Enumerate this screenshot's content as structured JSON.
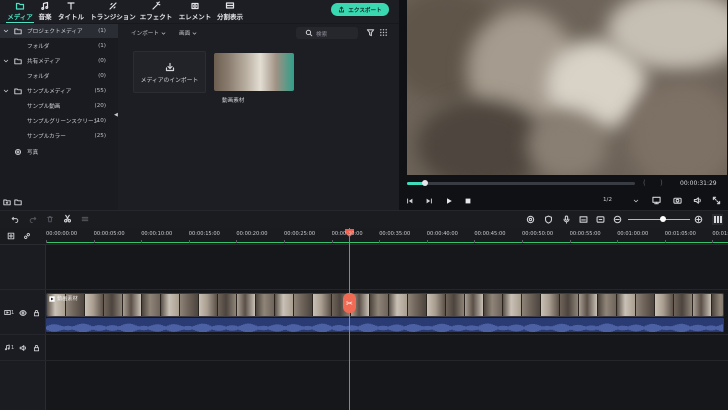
{
  "toolbar": {
    "tabs": [
      {
        "label": "メディア",
        "icon": "folder-icon"
      },
      {
        "label": "音楽",
        "icon": "music-icon"
      },
      {
        "label": "タイトル",
        "icon": "title-icon"
      },
      {
        "label": "トランジション",
        "icon": "transition-icon"
      },
      {
        "label": "エフェクト",
        "icon": "effect-icon"
      },
      {
        "label": "エレメント",
        "icon": "element-icon"
      },
      {
        "label": "分割表示",
        "icon": "split-screen-icon"
      }
    ],
    "export_label": "エクスポート"
  },
  "tree": {
    "items": [
      {
        "label": "プロジェクトメディア",
        "count": "(1)",
        "top_level": true
      },
      {
        "label": "フォルダ",
        "count": "(1)",
        "top_level": false
      },
      {
        "label": "共有メディア",
        "count": "(0)",
        "top_level": true
      },
      {
        "label": "フォルダ",
        "count": "(0)",
        "top_level": false
      },
      {
        "label": "サンプルメディア",
        "count": "(55)",
        "top_level": true
      },
      {
        "label": "サンプル動画",
        "count": "(20)",
        "top_level": false
      },
      {
        "label": "サンプルグリーンスクリーン",
        "count": "(10)",
        "top_level": false
      },
      {
        "label": "サンプルカラー",
        "count": "(25)",
        "top_level": false
      }
    ],
    "photo_label": "写真"
  },
  "media": {
    "import_dropdown": "インポート",
    "view_dropdown": "画面",
    "search_placeholder": "検索",
    "import_card_label": "メディアのインポート",
    "clip_name": "動画素材"
  },
  "preview": {
    "timecode": "00:00:31:29",
    "quality": "1/2",
    "progress": 0.08
  },
  "ruler": {
    "ticks": [
      "00:00:00:00",
      "00:00:05:00",
      "00:00:10:00",
      "00:00:15:00",
      "00:00:20:00",
      "00:00:25:00",
      "00:00:30:00",
      "00:00:35:00",
      "00:00:40:00",
      "00:00:45:00",
      "00:00:50:00",
      "00:00:55:00",
      "00:01:00:00",
      "00:01:05:00",
      "00:01:10:00"
    ]
  },
  "tracks": {
    "video_track_label": "1",
    "audio_track_label": "1",
    "clip_label": "動画素材"
  },
  "colors": {
    "accent": "#39d8b1",
    "playhead": "#f25c4a",
    "audio_wave": "#2a3a72"
  }
}
